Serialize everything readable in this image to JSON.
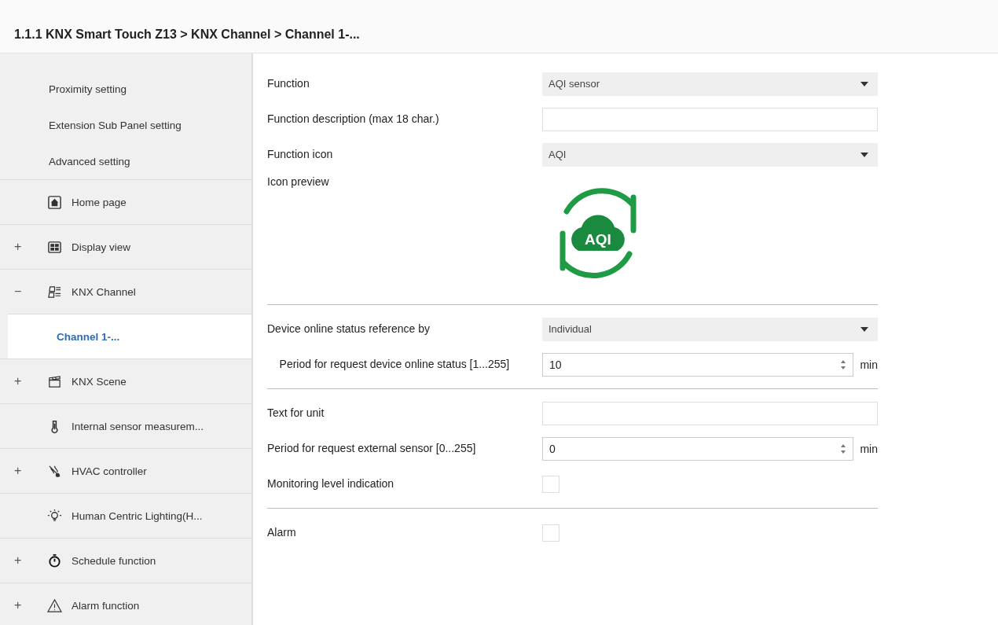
{
  "breadcrumb": "1.1.1 KNX Smart Touch Z13 > KNX Channel  > Channel 1-...",
  "sidebar": {
    "items": [
      {
        "kind": "sub",
        "label": "Proximity setting",
        "selected": false
      },
      {
        "kind": "sub",
        "label": "Extension Sub Panel setting",
        "selected": false
      },
      {
        "kind": "sub",
        "label": "Advanced setting",
        "selected": false
      },
      {
        "kind": "node",
        "label": "Home page",
        "selected": false
      },
      {
        "kind": "node",
        "expander": "+",
        "label": "Display view",
        "selected": false
      },
      {
        "kind": "node",
        "expander": "−",
        "label": "KNX Channel",
        "selected": false
      },
      {
        "kind": "child",
        "label": "Channel 1-...",
        "selected": true
      },
      {
        "kind": "node",
        "expander": "+",
        "label": "KNX Scene",
        "selected": false
      },
      {
        "kind": "node",
        "label": "Internal sensor measurem...",
        "selected": false
      },
      {
        "kind": "node",
        "expander": "+",
        "label": "HVAC controller",
        "selected": false
      },
      {
        "kind": "node",
        "label": "Human Centric Lighting(H...",
        "selected": false
      },
      {
        "kind": "node",
        "expander": "+",
        "label": "Schedule function",
        "selected": false
      },
      {
        "kind": "node",
        "expander": "+",
        "label": "Alarm function",
        "selected": false
      }
    ]
  },
  "form": [
    {
      "kind": "select",
      "label": "Function",
      "value": "AQI sensor"
    },
    {
      "kind": "text",
      "label": "Function description (max 18 char.)"
    },
    {
      "kind": "select",
      "label": "Function icon",
      "value": "AQI"
    },
    {
      "kind": "preview",
      "label": "Icon preview",
      "icon_text": "AQI"
    },
    {
      "kind": "divider"
    },
    {
      "kind": "select",
      "label": "Device online status reference by",
      "value": "Individual"
    },
    {
      "kind": "number",
      "label": "    Period for request device online status [1...255]",
      "value": "10",
      "unit": "min"
    },
    {
      "kind": "divider"
    },
    {
      "kind": "text",
      "label": "Text for unit"
    },
    {
      "kind": "number",
      "label": "Period for request external sensor [0...255]",
      "value": "0",
      "unit": "min"
    },
    {
      "kind": "checkbox",
      "label": "Monitoring level indication",
      "checked": false
    },
    {
      "kind": "divider"
    },
    {
      "kind": "checkbox",
      "label": "Alarm",
      "checked": false
    }
  ]
}
